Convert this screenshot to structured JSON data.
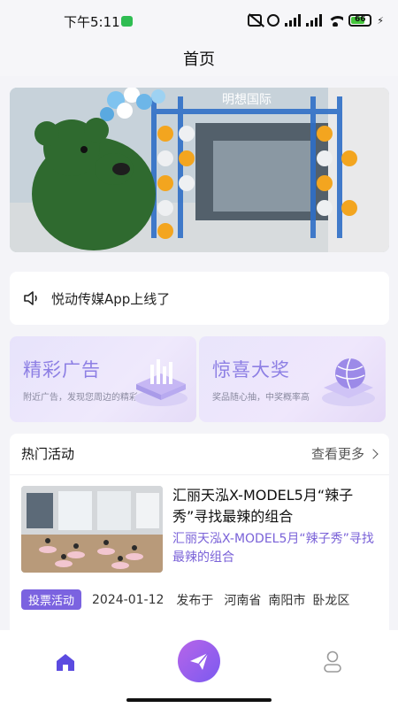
{
  "status_bar": {
    "time": "下午5:11",
    "battery_level": "66",
    "battery_fraction": 0.66,
    "icons": [
      "wechat-icon",
      "mute-icon",
      "alarm-icon",
      "signal-icon",
      "signal-icon",
      "wifi-icon",
      "battery-icon",
      "charging-bolt-icon"
    ]
  },
  "header": {
    "title": "首页"
  },
  "banner": {
    "sign_text": "明想国际"
  },
  "notice": {
    "icon": "speaker-icon",
    "text": "悦动传媒App上线了"
  },
  "promos": [
    {
      "title": "精彩广告",
      "subtitle": "附近广告，发现您周边的精彩"
    },
    {
      "title": "惊喜大奖",
      "subtitle": "奖品随心抽，中奖概率高"
    }
  ],
  "hot_activities": {
    "title": "热门活动",
    "more_label": "查看更多",
    "items": [
      {
        "title": "汇丽天泓X-MODEL5月“辣子秀”寻找最辣的组合",
        "subtitle": "汇丽天泓X-MODEL5月“辣子秀”寻找最辣的组合",
        "badge": "投票活动",
        "date": "2024-01-12",
        "published_label": "发布于",
        "province": "河南省",
        "city": "南阳市",
        "district": "卧龙区"
      }
    ]
  },
  "tabbar": {
    "items": [
      "home-icon",
      "publish-icon",
      "profile-icon"
    ],
    "active": "home"
  },
  "colors": {
    "accent": "#7b63e0",
    "promo_title": "#8d7fe4",
    "tab_active": "#5b4be0",
    "battery": "#45c53c"
  }
}
